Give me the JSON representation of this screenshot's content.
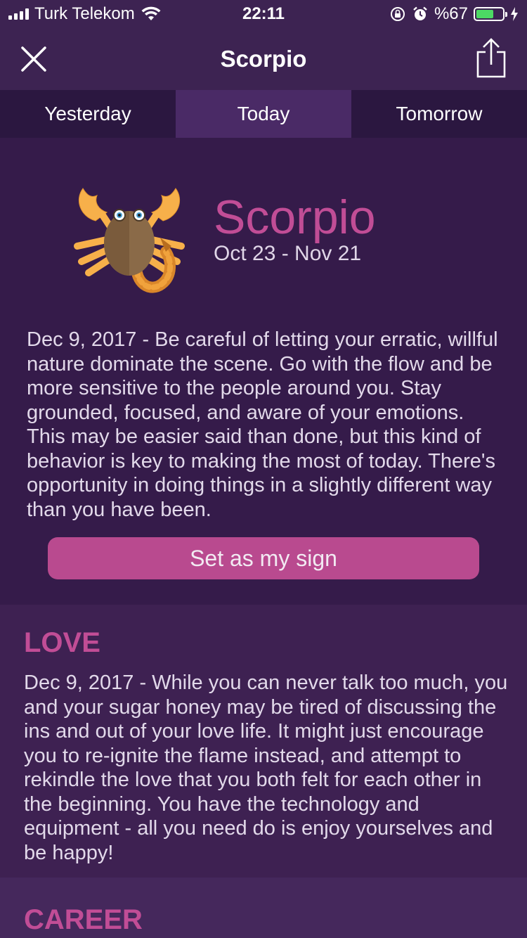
{
  "status": {
    "carrier": "Turk Telekom",
    "time": "22:11",
    "battery": "%67",
    "battery_level": 0.67
  },
  "nav": {
    "title": "Scorpio"
  },
  "tabs": [
    {
      "label": "Yesterday",
      "active": false
    },
    {
      "label": "Today",
      "active": true
    },
    {
      "label": "Tomorrow",
      "active": false
    }
  ],
  "sign": {
    "name": "Scorpio",
    "dates": "Oct 23 - Nov 21",
    "daily_text": "Dec 9, 2017 - Be careful of letting your erratic, willful nature dominate the scene. Go with the flow and be more sensitive to the people around you. Stay grounded, focused, and aware of your emotions. This may be easier said than done, but this kind of behavior is key to making the most of today. There's opportunity in doing things in a slightly different way than you have been.",
    "button_label": "Set as my sign"
  },
  "love": {
    "title": "LOVE",
    "text": "Dec 9, 2017 - While you can never talk too much, you and your sugar honey may be tired of discussing the ins and out of your love life. It might just encourage you to re-ignite the flame instead, and attempt to rekindle the love that you both felt for each other in the beginning. You have the technology and equipment - all you need do is enjoy yourselves and be happy!"
  },
  "career": {
    "title": "CAREER"
  },
  "colors": {
    "accent": "#c14d96",
    "button": "#b94a8f",
    "background": "#351b4a",
    "battery": "#4cd964"
  },
  "icons": [
    "signal-icon",
    "wifi-icon",
    "rotation-lock-icon",
    "alarm-icon",
    "battery-icon",
    "charging-icon",
    "close-icon",
    "share-icon",
    "scorpion-icon"
  ]
}
